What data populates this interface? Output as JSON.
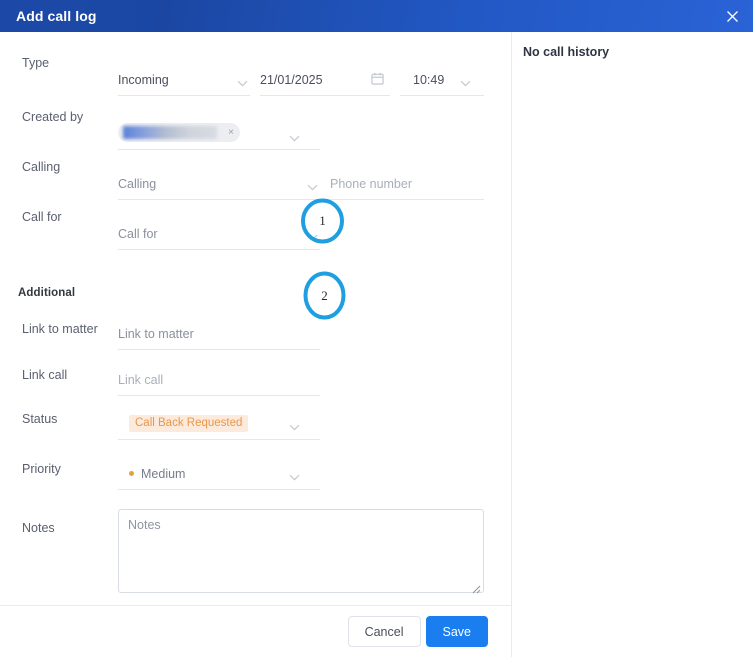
{
  "window": {
    "title": "Add call log",
    "close_icon": "close-icon"
  },
  "left_panel": {
    "rows": [
      {
        "label": "Type",
        "type_value": "Incoming",
        "date_value": "21/01/2025",
        "time_value": "10:49",
        "calendar_icon": "calendar-icon"
      },
      {
        "label": "Created by",
        "chip_removable": "×"
      },
      {
        "label": "Calling",
        "select_placeholder": "Calling",
        "phone_placeholder": "Phone number"
      },
      {
        "label": "Call for",
        "select_placeholder": "Call for"
      }
    ],
    "section_additional": "Additional",
    "additional_rows": [
      {
        "label": "Link to matter",
        "placeholder": "Link to matter"
      },
      {
        "label": "Link call",
        "placeholder": "Link call"
      },
      {
        "label": "Status",
        "badge": "Call Back Requested"
      },
      {
        "label": "Priority",
        "value": "Medium"
      },
      {
        "label": "Notes",
        "placeholder": "Notes"
      }
    ],
    "footer": {
      "cancel_label": "Cancel",
      "save_label": "Save"
    }
  },
  "right_panel": {
    "empty_message": "No call history"
  },
  "annotations": [
    {
      "number": "1"
    },
    {
      "number": "2"
    }
  ],
  "colors": {
    "header_blue": "#1f4fb0",
    "save_blue": "#1a7ef0",
    "annotation_blue": "#1f9fe0",
    "status_badge_bg": "#fcebdc",
    "status_badge_text": "#e8974b",
    "priority_dot": "#e2a33c"
  }
}
